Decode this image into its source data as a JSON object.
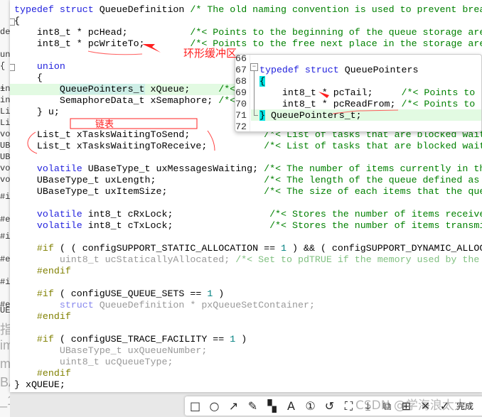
{
  "background_fragments": [
    "def",
    "int",
    "int",
    "uni",
    "{",
    "+ u",
    "Lis",
    "Lis",
    "vol",
    "UBa",
    "UBa",
    "vol",
    "vol",
    "#if",
    "#en",
    "#if",
    "#en",
    "#if",
    "#en",
    "UEU"
  ],
  "background_fragments_large": [
    "指)",
    "im",
    "m",
    "BA",
    "_16)"
  ],
  "code_lines": [
    [
      [
        "typedef struct ",
        "kw"
      ],
      [
        "QueueDefinition ",
        ""
      ],
      [
        "/* The old naming convention is used to prevent breaking",
        "cm"
      ]
    ],
    [
      [
        "{",
        ""
      ]
    ],
    [
      [
        "    int8_t * pcHead;           ",
        ""
      ],
      [
        "/*< Points to the beginning of the queue storage area.",
        "cm"
      ]
    ],
    [
      [
        "    int8_t * pcWriteTo;        ",
        ""
      ],
      [
        "/*< Points to the free next place in the storage area.",
        "cm"
      ]
    ],
    [],
    [
      [
        "    union",
        "kw"
      ]
    ],
    [
      [
        "    {",
        ""
      ]
    ],
    [
      [
        "        ",
        ""
      ],
      [
        "QueuePointers_t",
        "sel"
      ],
      [
        " xQueue;     ",
        ""
      ],
      [
        "/*<",
        "cm"
      ]
    ],
    [
      [
        "        SemaphoreData_t xSemaphore; ",
        ""
      ],
      [
        "/*<",
        "cm"
      ]
    ],
    [
      [
        "    } u;",
        ""
      ]
    ],
    [],
    [
      [
        "    List_t xTasksWaitingToSend;             ",
        ""
      ],
      [
        "/*< List of tasks that are blocked waiting",
        "cm"
      ]
    ],
    [
      [
        "    List_t xTasksWaitingToReceive;          ",
        ""
      ],
      [
        "/*< List of tasks that are blocked waiting",
        "cm"
      ]
    ],
    [],
    [
      [
        "    volatile ",
        "kw"
      ],
      [
        "UBaseType_t uxMessagesWaiting; ",
        ""
      ],
      [
        "/*< The number of items currently in the",
        "cm"
      ]
    ],
    [
      [
        "    UBaseType_t uxLength;                   ",
        ""
      ],
      [
        "/*< The length of the queue defined as the",
        "cm"
      ]
    ],
    [
      [
        "    UBaseType_t uxItemSize;                 ",
        ""
      ],
      [
        "/*< The size of each items that the queue",
        "cm"
      ]
    ],
    [],
    [
      [
        "    volatile ",
        "kw"
      ],
      [
        "int8_t cRxLock;                 ",
        ""
      ],
      [
        "/*< Stores the number of items received",
        "cm"
      ]
    ],
    [
      [
        "    volatile ",
        "kw"
      ],
      [
        "int8_t cTxLock;                 ",
        ""
      ],
      [
        "/*< Stores the number of items transmitted",
        "cm"
      ]
    ],
    [],
    [
      [
        "    #if",
        "pp"
      ],
      [
        " ( ( configSUPPORT_STATIC_ALLOCATION == ",
        ""
      ],
      [
        "1",
        "num"
      ],
      [
        " ) && ( configSUPPORT_DYNAMIC_ALLOCATION",
        ""
      ]
    ],
    [
      [
        "        uint8_t ucStaticallyAllocated; ",
        "in"
      ],
      [
        "/*< Set to pdTRUE if the memory used by the",
        "incm"
      ]
    ],
    [
      [
        "    #endif",
        "pp"
      ]
    ],
    [],
    [
      [
        "    #if",
        "pp"
      ],
      [
        " ( configUSE_QUEUE_SETS == ",
        ""
      ],
      [
        "1",
        "num"
      ],
      [
        " )",
        ""
      ]
    ],
    [
      [
        "        struct ",
        "inkw"
      ],
      [
        "QueueDefinition * pxQueueSetContainer;",
        "in"
      ]
    ],
    [
      [
        "    #endif",
        "pp"
      ]
    ],
    [],
    [
      [
        "    #if",
        "pp"
      ],
      [
        " ( configUSE_TRACE_FACILITY == ",
        ""
      ],
      [
        "1",
        "num"
      ],
      [
        " )",
        ""
      ]
    ],
    [
      [
        "        UBaseType_t uxQueueNumber;",
        "in"
      ]
    ],
    [
      [
        "        uint8_t ucQueueType;",
        "in"
      ]
    ],
    [
      [
        "    #endif",
        "pp"
      ]
    ],
    [
      [
        "} xQUEUE;",
        ""
      ]
    ]
  ],
  "popup": {
    "line_numbers": [
      "66",
      "67",
      "68",
      "69",
      "70",
      "71",
      "72"
    ],
    "lines": [
      [],
      [
        [
          "typedef struct ",
          "kw"
        ],
        [
          "QueuePointers",
          ""
        ]
      ],
      [
        [
          "{",
          "cy"
        ]
      ],
      [
        [
          "    int8_t * pcTail;     ",
          ""
        ],
        [
          "/*< Points to the",
          "cm"
        ]
      ],
      [
        [
          "    int8_t * pcReadFrom; ",
          ""
        ],
        [
          "/*< Points to the",
          "cm"
        ]
      ],
      [
        [
          "}",
          "cy"
        ],
        [
          " QueuePointers_t;",
          ""
        ]
      ],
      []
    ]
  },
  "annotations": {
    "ring_buffer": "环形缓冲区",
    "linked_list": "链表",
    "color": "#ff2020"
  },
  "toolbar": {
    "tools": [
      {
        "name": "rectangle",
        "glyph": "□"
      },
      {
        "name": "ellipse",
        "glyph": "○"
      },
      {
        "name": "arrow",
        "glyph": "↗"
      },
      {
        "name": "pen",
        "glyph": "✎"
      },
      {
        "name": "mosaic",
        "glyph": "▚"
      },
      {
        "name": "text",
        "glyph": "A"
      },
      {
        "name": "number",
        "glyph": "①"
      },
      {
        "name": "undo",
        "glyph": "↺"
      },
      {
        "name": "pin",
        "glyph": "⛶"
      },
      {
        "name": "save",
        "glyph": "⤓"
      },
      {
        "name": "copy",
        "glyph": "⧉"
      },
      {
        "name": "translate",
        "glyph": "⊞"
      },
      {
        "name": "close",
        "glyph": "✕"
      },
      {
        "name": "confirm",
        "glyph": "✓"
      }
    ],
    "done_label": "完成"
  },
  "watermark": "CSDN @学海浪太大"
}
